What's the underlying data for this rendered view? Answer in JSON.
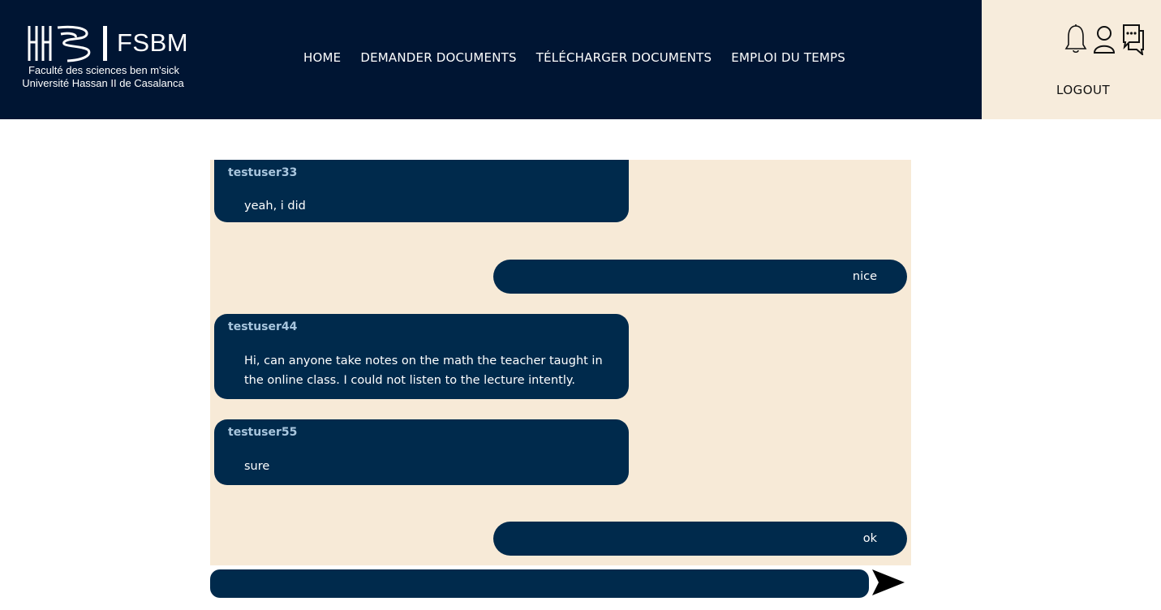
{
  "header": {
    "logo": {
      "acronym": "FSBM",
      "line1": "Faculté des sciences ben m'sick",
      "line2": "Université Hassan II de Casalanca"
    },
    "nav": [
      {
        "label": "HOME"
      },
      {
        "label": "DEMANDER DOCUMENTS"
      },
      {
        "label": "TÉLÉCHARGER DOCUMENTS"
      },
      {
        "label": "EMPLOI DU TEMPS"
      }
    ]
  },
  "user_panel": {
    "icons": [
      "bell-icon",
      "user-icon",
      "chat-icon"
    ],
    "logout_label": "LOGOUT"
  },
  "chat": {
    "messages": [
      {
        "side": "left",
        "user": "testuser33",
        "text": "yeah, i did"
      },
      {
        "side": "right",
        "user": "",
        "text": "nice"
      },
      {
        "side": "left",
        "user": "testuser44",
        "text": "Hi, can anyone take notes on the math the teacher taught in the online class. I could not listen to the lecture intently."
      },
      {
        "side": "left",
        "user": "testuser55",
        "text": "sure"
      },
      {
        "side": "right",
        "user": "",
        "text": "ok"
      }
    ],
    "composer_value": "",
    "send_icon": "send-arrow-icon"
  },
  "colors": {
    "header_bg": "#001533",
    "panel_bg": "#f7ecdc",
    "chat_bg": "#f7ead7",
    "bubble_bg": "#002a4c",
    "username": "#a9c6de"
  }
}
